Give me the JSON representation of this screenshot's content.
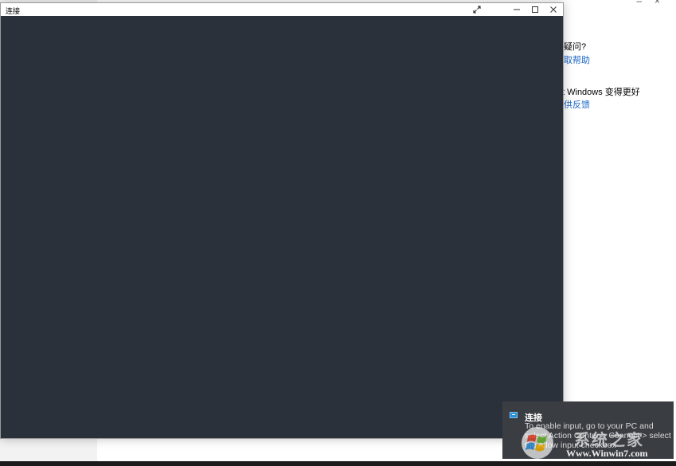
{
  "background_settings": {
    "questions_heading": "疑问?",
    "get_help_link": "取帮助",
    "feedback_heading": "t Windows 变得更好",
    "feedback_link": "供反馈"
  },
  "connect_window": {
    "title": "连接",
    "controls": {
      "expand_icon": "expand-icon",
      "minimize_icon": "minimize-icon",
      "maximize_icon": "maximize-icon",
      "close_icon": "close-icon"
    },
    "content_color": "#2b313a"
  },
  "toast": {
    "app_name": "连接",
    "message": "To enable input, go to your PC and select Action Center > Connect > select the Allow input checkbox",
    "icon": "connect-app-icon",
    "background": "#3a3d42"
  },
  "watermark": {
    "name": "系统之家",
    "url": "Www.Winwin7.com"
  }
}
